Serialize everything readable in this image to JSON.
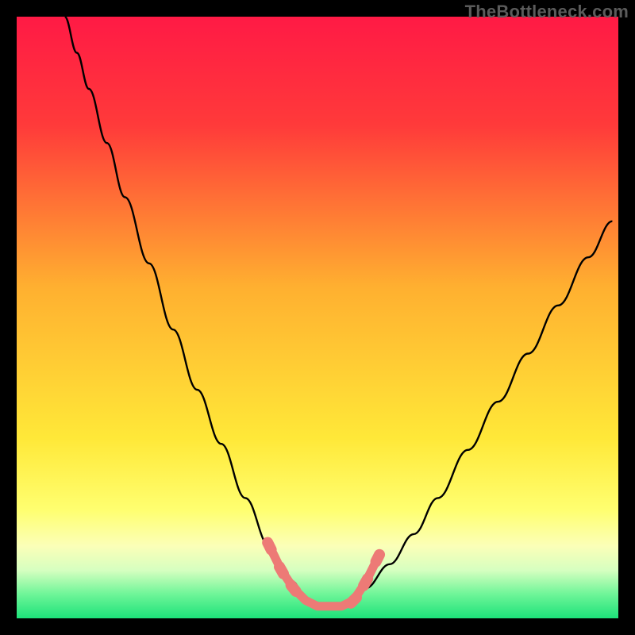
{
  "watermark": "TheBottleneck.com",
  "chart_data": {
    "type": "line",
    "title": "",
    "xlabel": "",
    "ylabel": "",
    "xlim": [
      0,
      100
    ],
    "ylim": [
      0,
      100
    ],
    "gradient_stops": [
      {
        "offset": 0,
        "color": "#ff1a45"
      },
      {
        "offset": 0.18,
        "color": "#ff3a3a"
      },
      {
        "offset": 0.45,
        "color": "#ffb030"
      },
      {
        "offset": 0.7,
        "color": "#ffe838"
      },
      {
        "offset": 0.82,
        "color": "#ffff70"
      },
      {
        "offset": 0.88,
        "color": "#fbffb8"
      },
      {
        "offset": 0.92,
        "color": "#d6ffc0"
      },
      {
        "offset": 0.96,
        "color": "#6ef598"
      },
      {
        "offset": 1.0,
        "color": "#1de27a"
      }
    ],
    "series": [
      {
        "name": "bottleneck-curve",
        "color": "#000000",
        "x": [
          8,
          10,
          12,
          15,
          18,
          22,
          26,
          30,
          34,
          38,
          42,
          46,
          48,
          50,
          52,
          54,
          56,
          58,
          62,
          66,
          70,
          75,
          80,
          85,
          90,
          95,
          99
        ],
        "y": [
          100,
          94,
          88,
          79,
          70,
          59,
          48,
          38,
          29,
          20,
          12,
          6,
          3,
          2,
          2,
          2,
          3,
          5,
          9,
          14,
          20,
          28,
          36,
          44,
          52,
          60,
          66
        ]
      }
    ],
    "markers": {
      "name": "flat-region-markers",
      "color": "#ed7a76",
      "x": [
        42,
        44,
        46,
        48,
        50,
        52,
        54,
        56,
        58,
        60
      ],
      "y": [
        12,
        8,
        5,
        3,
        2,
        2,
        2,
        3,
        6,
        10
      ]
    }
  }
}
